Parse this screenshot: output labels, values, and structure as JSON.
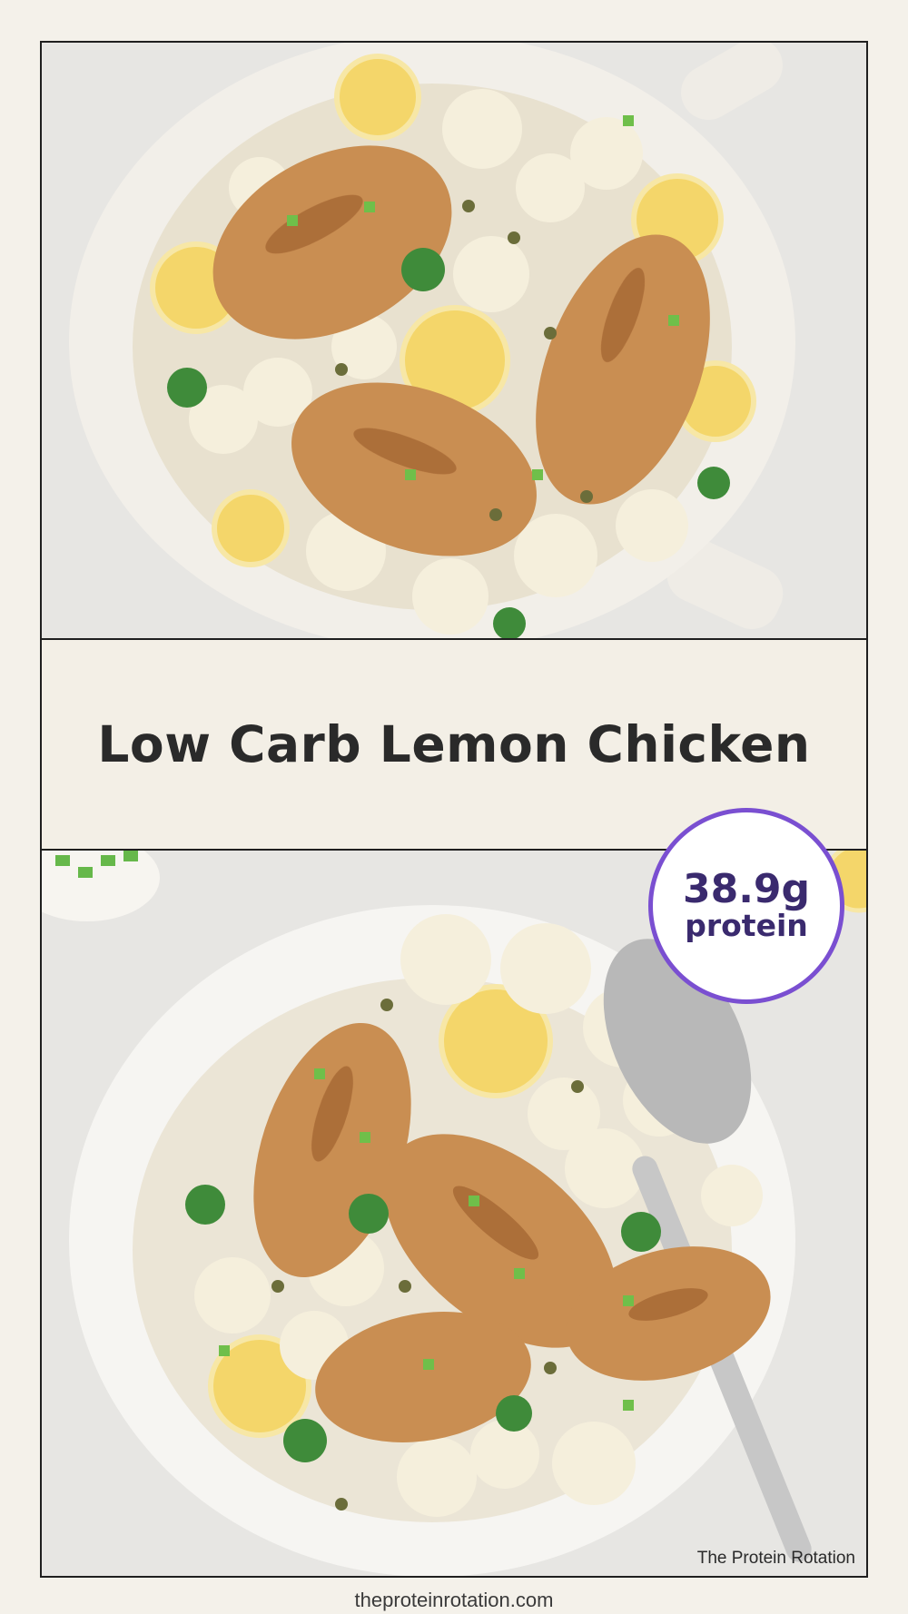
{
  "title": "Low Carb Lemon Chicken",
  "badge": {
    "amount": "38.9g",
    "label": "protein"
  },
  "watermark": "The Protein Rotation",
  "footer_url": "theproteinrotation.com",
  "colors": {
    "badge_border": "#7a4fd1",
    "badge_text": "#3a2a6e",
    "title_text": "#2a2a2a",
    "title_band": "#f3efe6"
  },
  "images": {
    "top": "food-photo-skillet-lemon-chicken",
    "bottom": "food-photo-bowl-lemon-chicken-with-spoon"
  }
}
